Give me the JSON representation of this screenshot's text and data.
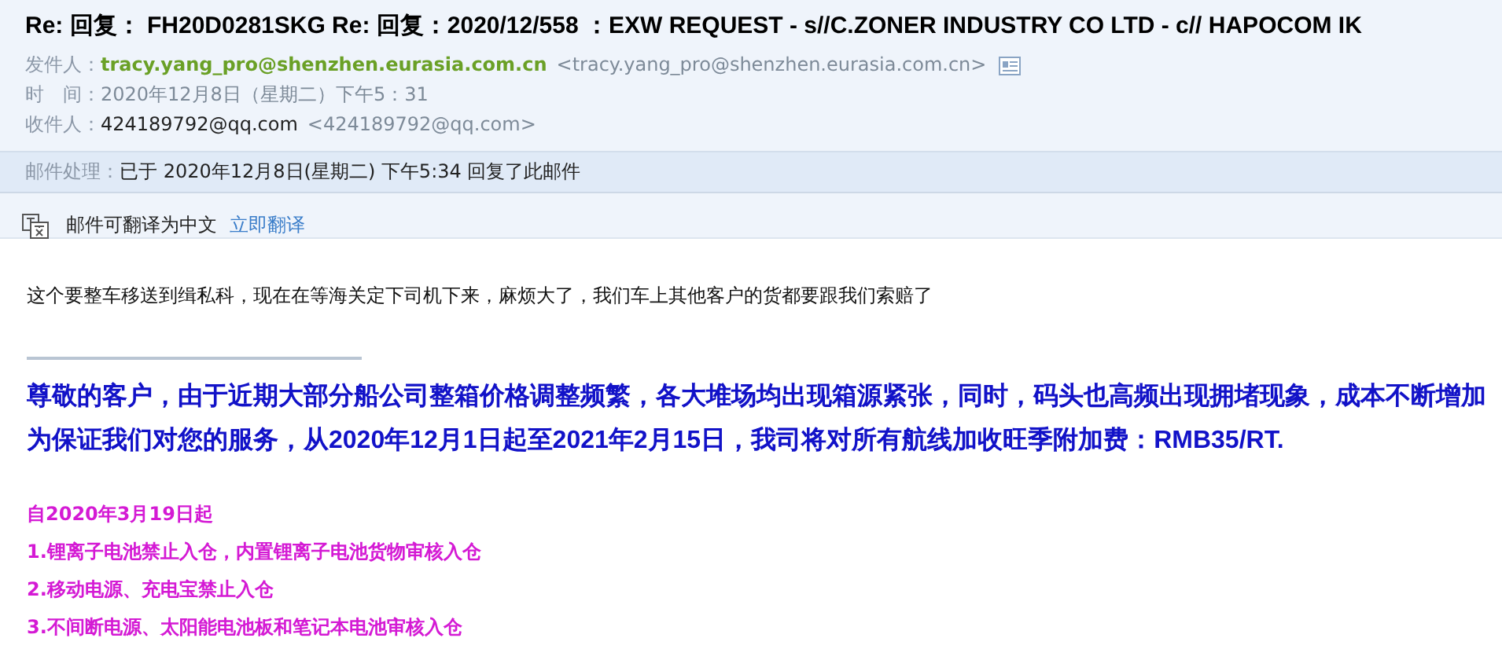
{
  "subject": "Re: 回复： FH20D0281SKG Re: 回复：2020/12/558 ：EXW REQUEST - s//C.ZONER INDUSTRY CO LTD - c// HAPOCOM IK",
  "meta": [
    {
      "kind": "sender",
      "label": "发件人：",
      "name": "tracy.yang_pro@shenzhen.eurasia.com.cn",
      "address": "<tracy.yang_pro@shenzhen.eurasia.com.cn>"
    },
    {
      "kind": "time",
      "label": "时　间：",
      "value": "2020年12月8日（星期二）下午5：31"
    },
    {
      "kind": "recipient",
      "label": "收件人：",
      "name": "424189792@qq.com",
      "address": "<424189792@qq.com>"
    }
  ],
  "processing": {
    "label": "邮件处理：",
    "value": "已于 2020年12月8日(星期二) 下午5:34 回复了此邮件"
  },
  "translate": {
    "text": "邮件可翻译为中文",
    "link": "立即翻译"
  },
  "body": [
    {
      "kind": "plain",
      "text": "这个要整车移送到缉私科，现在在等海关定下司机下来，麻烦大了，我们车上其他客户的货都要跟我们索赔了"
    },
    {
      "kind": "rule"
    },
    {
      "kind": "notice",
      "text": "尊敬的客户，由于近期大部分船公司整箱价格调整频繁，各大堆场均出现箱源紧张，同时，码头也高频出现拥堵现象，成本不断增加"
    },
    {
      "kind": "notice",
      "text": "为保证我们对您的服务，从2020年12月1日起至2021年2月15日，我司将对所有航线加收旺季附加费：RMB35/RT."
    },
    {
      "kind": "gap"
    },
    {
      "kind": "rule-item",
      "text": "自2020年3月19日起"
    },
    {
      "kind": "rule-item",
      "text": "1.锂离子电池禁止入仓，内置锂离子电池货物审核入仓"
    },
    {
      "kind": "rule-item",
      "text": "2.移动电源、充电宝禁止入仓"
    },
    {
      "kind": "rule-item",
      "text": "3.不间断电源、太阳能电池板和笔记本电池审核入仓"
    }
  ]
}
